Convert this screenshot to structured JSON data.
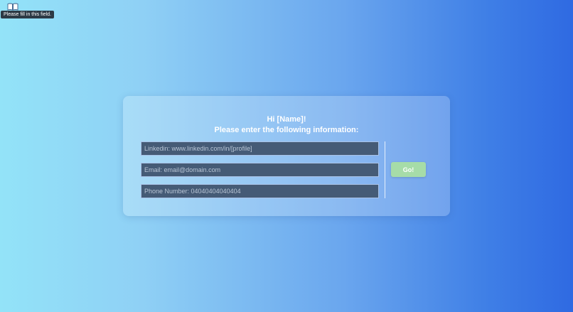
{
  "tooltip": {
    "text": "Please fill in this field."
  },
  "icons": {
    "corner": "book-open-icon"
  },
  "form": {
    "greeting_line1": "Hi [Name]!",
    "greeting_line2": "Please enter the following information:",
    "linkedin_placeholder": "Linkedin: www.linkedin.com/in/[profile]",
    "email_placeholder": "Email: email@domain.com",
    "phone_placeholder": "Phone Number: 04040404040404",
    "go_label": "Go!"
  },
  "colors": {
    "gradient_start": "#93e3f8",
    "gradient_end": "#2f6ae2",
    "input_bg": "#455b76",
    "button_bg": "#a6dca8"
  }
}
